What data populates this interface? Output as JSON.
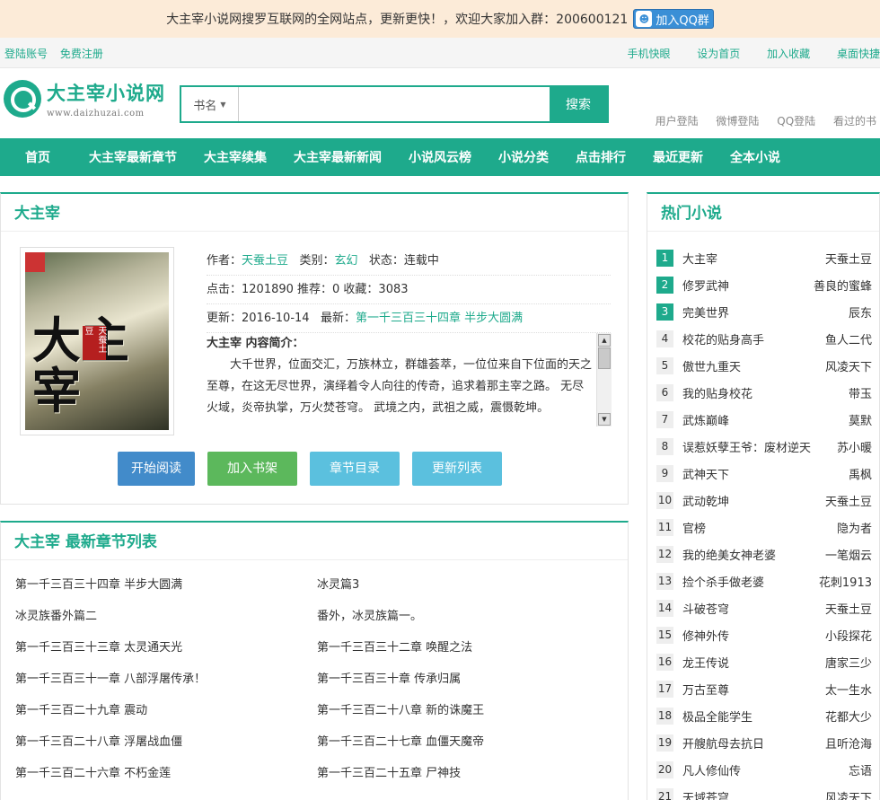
{
  "notice": {
    "text": "大主宰小说网搜罗互联网的全网站点，更新更快！，欢迎大家加入群：200600121",
    "qq_button": "加入QQ群"
  },
  "userbar": {
    "login": "登陆账号",
    "register": "免费注册",
    "links": [
      "手机快眼",
      "设为首页",
      "加入收藏",
      "桌面快捷"
    ]
  },
  "header": {
    "logo_name": "大主宰小说网",
    "logo_url": "www.daizhuzai.com",
    "search_select": "书名",
    "search_value": "",
    "search_button": "搜索",
    "links": [
      "用户登陆",
      "微博登陆",
      "QQ登陆",
      "看过的书"
    ]
  },
  "nav": [
    "首页",
    "大主宰最新章节",
    "大主宰续集",
    "大主宰最新新闻",
    "小说风云榜",
    "小说分类",
    "点击排行",
    "最近更新",
    "全本小说"
  ],
  "book": {
    "title": "大主宰",
    "cover_text": "大主宰",
    "cover_seal": "天蚕土豆",
    "author_label": "作者：",
    "author": "天蚕土豆",
    "category_label": "类别：",
    "category": "玄幻",
    "status": "状态：连载中",
    "stats": "点击：1201890  推荐：0  收藏：3083",
    "updated": "更新：2016-10-14",
    "latest_label": "最新：",
    "latest": "第一千三百三十四章 半步大圆满",
    "intro_title": "大主宰 内容简介：",
    "intro": "大千世界，位面交汇，万族林立，群雄荟萃，一位位来自下位面的天之至尊，在这无尽世界，演绎着令人向往的传奇，追求着那主宰之路。 无尽火域，炎帝执掌，万火焚苍穹。 武境之内，武祖之威，震慑乾坤。",
    "buttons": [
      "开始阅读",
      "加入书架",
      "章节目录",
      "更新列表"
    ],
    "button_colors": [
      "#428bca",
      "#5cb85c",
      "#5bc0de",
      "#5bc0de"
    ]
  },
  "chapters": {
    "title": "大主宰 最新章节列表",
    "items": [
      "第一千三百三十四章 半步大圆满",
      "冰灵篇3",
      "冰灵族番外篇二",
      "番外，冰灵族篇一。",
      "第一千三百三十三章 太灵通天光",
      "第一千三百三十二章 唤醒之法",
      "第一千三百三十一章 八部浮屠传承！",
      "第一千三百三十章 传承归属",
      "第一千三百二十九章 震动",
      "第一千三百二十八章 新的诛魔王",
      "第一千三百二十八章 浮屠战血僵",
      "第一千三百二十七章 血僵天魔帝",
      "第一千三百二十六章 不朽金莲",
      "第一千三百二十五章 尸神技"
    ]
  },
  "hot": {
    "title": "热门小说",
    "items": [
      {
        "n": "1",
        "book": "大主宰",
        "author": "天蚕土豆"
      },
      {
        "n": "2",
        "book": "修罗武神",
        "author": "善良的蜜蜂"
      },
      {
        "n": "3",
        "book": "完美世界",
        "author": "辰东"
      },
      {
        "n": "4",
        "book": "校花的贴身高手",
        "author": "鱼人二代"
      },
      {
        "n": "5",
        "book": "傲世九重天",
        "author": "风凌天下"
      },
      {
        "n": "6",
        "book": "我的贴身校花",
        "author": "带玉"
      },
      {
        "n": "7",
        "book": "武炼巅峰",
        "author": "莫默"
      },
      {
        "n": "8",
        "book": "误惹妖孽王爷：废材逆天",
        "author": "苏小暖"
      },
      {
        "n": "9",
        "book": "武神天下",
        "author": "禹枫"
      },
      {
        "n": "10",
        "book": "武动乾坤",
        "author": "天蚕土豆"
      },
      {
        "n": "11",
        "book": "官榜",
        "author": "隐为者"
      },
      {
        "n": "12",
        "book": "我的绝美女神老婆",
        "author": "一笔烟云"
      },
      {
        "n": "13",
        "book": "捡个杀手做老婆",
        "author": "花刺1913"
      },
      {
        "n": "14",
        "book": "斗破苍穹",
        "author": "天蚕土豆"
      },
      {
        "n": "15",
        "book": "修神外传",
        "author": "小段探花"
      },
      {
        "n": "16",
        "book": "龙王传说",
        "author": "唐家三少"
      },
      {
        "n": "17",
        "book": "万古至尊",
        "author": "太一生水"
      },
      {
        "n": "18",
        "book": "极品全能学生",
        "author": "花都大少"
      },
      {
        "n": "19",
        "book": "开艘航母去抗日",
        "author": "且听沧海"
      },
      {
        "n": "20",
        "book": "凡人修仙传",
        "author": "忘语"
      },
      {
        "n": "21",
        "book": "天域苍穹",
        "author": "风凌天下"
      }
    ]
  },
  "colors": {
    "accent": "#1eaa8c",
    "notice_bg": "#fcebd8"
  }
}
